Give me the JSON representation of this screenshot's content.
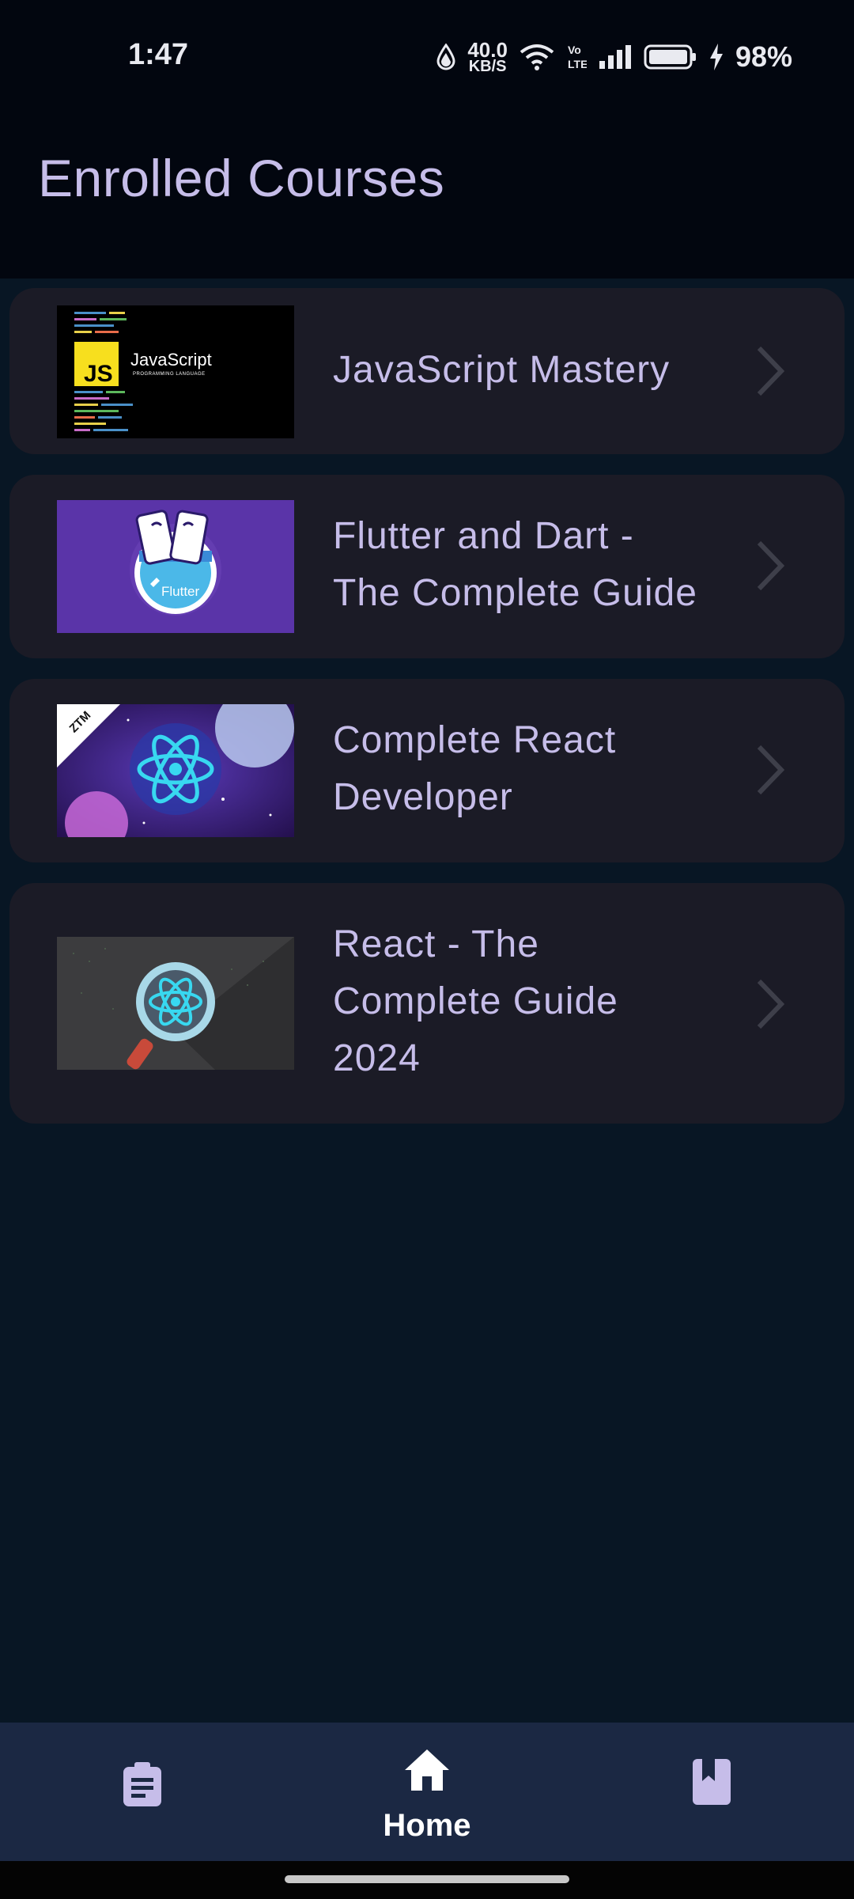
{
  "status_bar": {
    "time": "1:47",
    "net_speed_value": "40.0",
    "net_speed_unit": "KB/S",
    "battery": "98%",
    "icons": [
      "data-saver-icon",
      "wifi-icon",
      "volte-icon",
      "signal-icon",
      "battery-icon",
      "charging-icon"
    ]
  },
  "header": {
    "title": "Enrolled Courses"
  },
  "courses": [
    {
      "title_line1": "JavaScript Mastery",
      "thumb_text": "JavaScript",
      "thumb_badge": "JS",
      "thumb_sub": "PROGRAMMING LANGUAGE"
    },
    {
      "title_line1": "Flutter and Dart -",
      "title_line2": "The Complete Guide",
      "thumb_text": "Flutter"
    },
    {
      "title_line1": "Complete React",
      "title_line2": "Developer",
      "thumb_text": "ZTM"
    },
    {
      "title_line1": "React - The",
      "title_line2": "Complete Guide",
      "title_line3": "2024"
    }
  ],
  "bottom_nav": {
    "items": [
      {
        "icon": "assignment-icon",
        "label": ""
      },
      {
        "icon": "home-icon",
        "label": "Home",
        "active": true
      },
      {
        "icon": "bookmark-book-icon",
        "label": ""
      }
    ]
  },
  "colors": {
    "background": "#081624",
    "appbar": "#02060f",
    "card": "#1b1b26",
    "accent_text": "#c6bde9",
    "nav_background": "#1b2843"
  }
}
